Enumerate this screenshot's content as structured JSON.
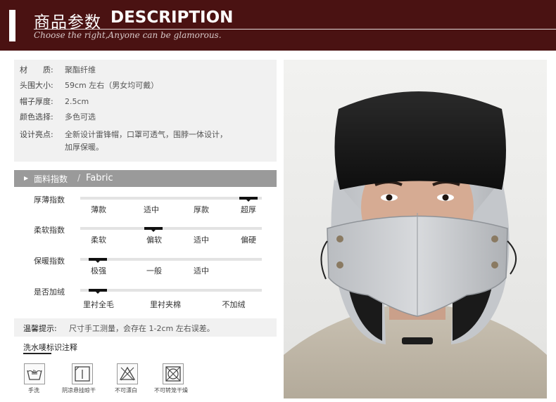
{
  "header": {
    "title_cn": "商品参数",
    "title_en": "DESCRIPTION",
    "subtitle": "Choose the right,Anyone can be glamorous."
  },
  "specs": [
    {
      "label": "材　　质:",
      "value": "聚酯纤维"
    },
    {
      "label": "头围大小:",
      "value": "59cm 左右（男女均可戴）"
    },
    {
      "label": "帽子厚度:",
      "value": "2.5cm"
    },
    {
      "label": "颜色选择:",
      "value": "多色可选"
    },
    {
      "label": "设计亮点:",
      "value": "全新设计雷锋帽，口罩可透气，围脖一体设计，",
      "value2": "加厚保暖。"
    }
  ],
  "fabric": {
    "title_cn": "面料指数",
    "separator": "/",
    "title_en": "Fabric",
    "indices": [
      {
        "label": "厚薄指数",
        "options": [
          "薄款",
          "适中",
          "厚款",
          "超厚"
        ],
        "selected": 3
      },
      {
        "label": "柔软指数",
        "options": [
          "柔软",
          "偏软",
          "适中",
          "偏硬"
        ],
        "selected": 1
      },
      {
        "label": "保暖指数",
        "options": [
          "极强",
          "一般",
          "适中"
        ],
        "selected": 0
      },
      {
        "label": "是否加绒",
        "options": [
          "里衬全毛",
          "里衬夹棉",
          "不加绒"
        ],
        "selected": 0
      }
    ]
  },
  "tip": {
    "label": "温馨提示:",
    "text": "尺寸手工测量，会存在 1-2cm 左右误差。"
  },
  "wash": {
    "title": "洗水唛标识注释",
    "icons": [
      {
        "icon": "hand-wash-icon",
        "caption": "手洗"
      },
      {
        "icon": "shade-drip-dry-icon",
        "caption": "阴凉悬挂晾干"
      },
      {
        "icon": "no-bleach-icon",
        "caption": "不可漂白"
      },
      {
        "icon": "no-tumble-dry-icon",
        "caption": "不可转笼干燥"
      }
    ]
  },
  "colors": {
    "header_bg": "#4a1212",
    "panel_bg": "#f1f1f1",
    "fabric_head_bg": "#9a9a9a"
  }
}
